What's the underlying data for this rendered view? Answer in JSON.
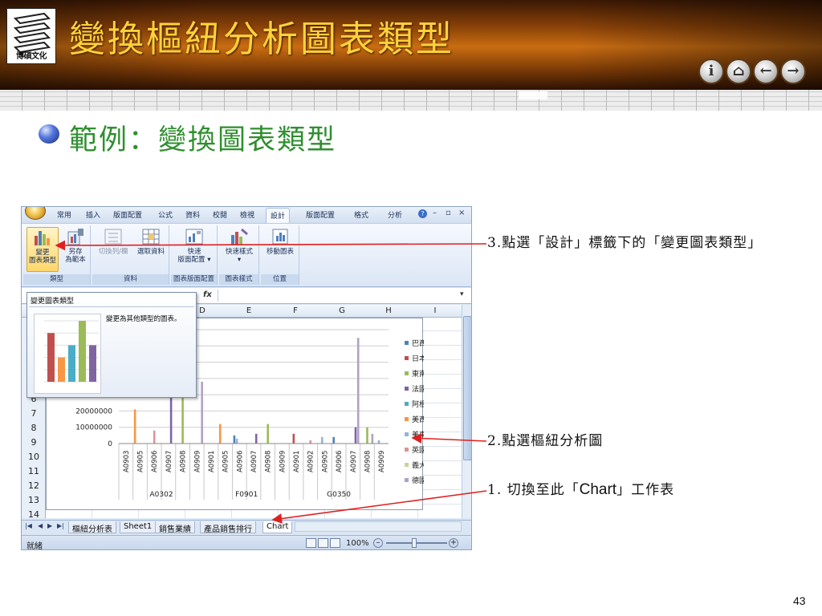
{
  "slide": {
    "title": "變換樞紐分析圖表類型",
    "bullet": "範例：變換圖表類型",
    "page_number": "43",
    "logo_text": "博碩文化",
    "nav_buttons": [
      {
        "name": "info",
        "glyph": "i"
      },
      {
        "name": "home",
        "glyph": "⌂"
      },
      {
        "name": "back",
        "glyph": "←"
      },
      {
        "name": "forward",
        "glyph": "→"
      }
    ],
    "colors": {
      "title": "#ffd23a",
      "bullet_text": "#2f8f2f",
      "callout_line": "#e02020"
    }
  },
  "excel": {
    "ribbon_tabs": [
      "常用",
      "插入",
      "版面配置",
      "公式",
      "資料",
      "校閱",
      "檢視",
      "設計",
      "版面配置",
      "格式",
      "分析"
    ],
    "active_tab": "設計",
    "ribbon_groups": [
      {
        "caption": "類型",
        "buttons": [
          {
            "label_line1": "變更",
            "label_line2": "圖表類型",
            "icon": "bar-chart-icon"
          },
          {
            "label_line1": "另存",
            "label_line2": "為範本",
            "icon": "template-icon"
          }
        ]
      },
      {
        "caption": "資料",
        "buttons": [
          {
            "label_line1": "切換列/欄",
            "label_line2": "",
            "icon": "switch-row-col-icon"
          },
          {
            "label_line1": "選取資料",
            "label_line2": "",
            "icon": "select-data-icon"
          }
        ]
      },
      {
        "caption": "圖表版面配置",
        "buttons": [
          {
            "label_line1": "快速",
            "label_line2": "版面配置 ▾",
            "icon": "quick-layout-icon"
          }
        ]
      },
      {
        "caption": "圖表樣式",
        "buttons": [
          {
            "label_line1": "快速樣式",
            "label_line2": "▾",
            "icon": "quick-style-icon"
          }
        ]
      },
      {
        "caption": "位置",
        "buttons": [
          {
            "label_line1": "移動圖表",
            "label_line2": "",
            "icon": "move-chart-icon"
          }
        ]
      }
    ],
    "tooltip": {
      "title": "變更圖表類型",
      "description": "變更為其他類型的圖表。"
    },
    "tooltip_thumbnail": {
      "values": [
        4,
        2,
        3,
        5,
        3
      ],
      "colors": [
        "#c0504d",
        "#f79646",
        "#4bacc6",
        "#9bbb59",
        "#8064a2"
      ]
    },
    "formula_symbol": "fx",
    "column_headers": [
      "D",
      "E",
      "F",
      "G",
      "H",
      "I"
    ],
    "row_headers": [
      "6",
      "7",
      "8",
      "9",
      "10",
      "11",
      "12",
      "13",
      "14"
    ],
    "sheet_tabs": [
      "樞紐分析表",
      "Sheet1",
      "銷售業績",
      "產品銷售排行",
      "Chart"
    ],
    "active_sheet": "Chart",
    "status_text": "就緒",
    "zoom_text": "100%"
  },
  "chart_data": {
    "type": "bar",
    "y_ticks": [
      "20000000",
      "10000000",
      "0"
    ],
    "groups": [
      {
        "label": "A0302",
        "categories": [
          "A0903",
          "A0905",
          "A0906",
          "A0907",
          "A0908",
          "A0909"
        ]
      },
      {
        "label": "F0901",
        "categories": [
          "A0901",
          "A0905",
          "A0906",
          "A0907",
          "A0908",
          "A0909"
        ]
      },
      {
        "label": "G0350",
        "categories": [
          "A0901",
          "A0902",
          "A0905",
          "A0906",
          "A0907",
          "A0908",
          "A0909"
        ]
      }
    ],
    "legend": [
      "巴西",
      "日本",
      "東南亞",
      "法國",
      "阿根廷",
      "美西",
      "美東",
      "英國",
      "義大利",
      "德國"
    ],
    "legend_colors": [
      "#4f81bd",
      "#c0504d",
      "#9bbb59",
      "#8064a2",
      "#4bacc6",
      "#f79646",
      "#95b3d7",
      "#d99694",
      "#c3d69b",
      "#b2a1c7"
    ],
    "bars": [
      {
        "category_index": 1,
        "series": 5,
        "value": 21000000
      },
      {
        "category_index": 2,
        "series": 7,
        "value": 8000000
      },
      {
        "category_index": 3,
        "series": 3,
        "value": 30000000
      },
      {
        "category_index": 4,
        "series": 2,
        "value": 38000000
      },
      {
        "category_index": 5,
        "series": 9,
        "value": 38000000
      },
      {
        "category_index": 7,
        "series": 5,
        "value": 12000000
      },
      {
        "category_index": 8,
        "series": 6,
        "value": 3000000
      },
      {
        "category_index": 8,
        "series": 0,
        "value": 5000000
      },
      {
        "category_index": 9,
        "series": 3,
        "value": 6000000
      },
      {
        "category_index": 10,
        "series": 2,
        "value": 12000000
      },
      {
        "category_index": 12,
        "series": 1,
        "value": 6000000
      },
      {
        "category_index": 13,
        "series": 7,
        "value": 2000000
      },
      {
        "category_index": 14,
        "series": 6,
        "value": 4000000
      },
      {
        "category_index": 15,
        "series": 0,
        "value": 4000000
      },
      {
        "category_index": 16,
        "series": 3,
        "value": 10000000
      },
      {
        "category_index": 16,
        "series": 9,
        "value": 65000000
      },
      {
        "category_index": 17,
        "series": 9,
        "value": 6000000
      },
      {
        "category_index": 17,
        "series": 2,
        "value": 10000000
      },
      {
        "category_index": 18,
        "series": 6,
        "value": 2000000
      }
    ]
  },
  "callouts": {
    "step3": "3.點選「設計」標籤下的「變更圖表類型」",
    "step2": "2.點選樞紐分析圖",
    "step1_prefix": "1. 切換至此「",
    "step1_latin": "Chart",
    "step1_suffix": "」工作表"
  }
}
